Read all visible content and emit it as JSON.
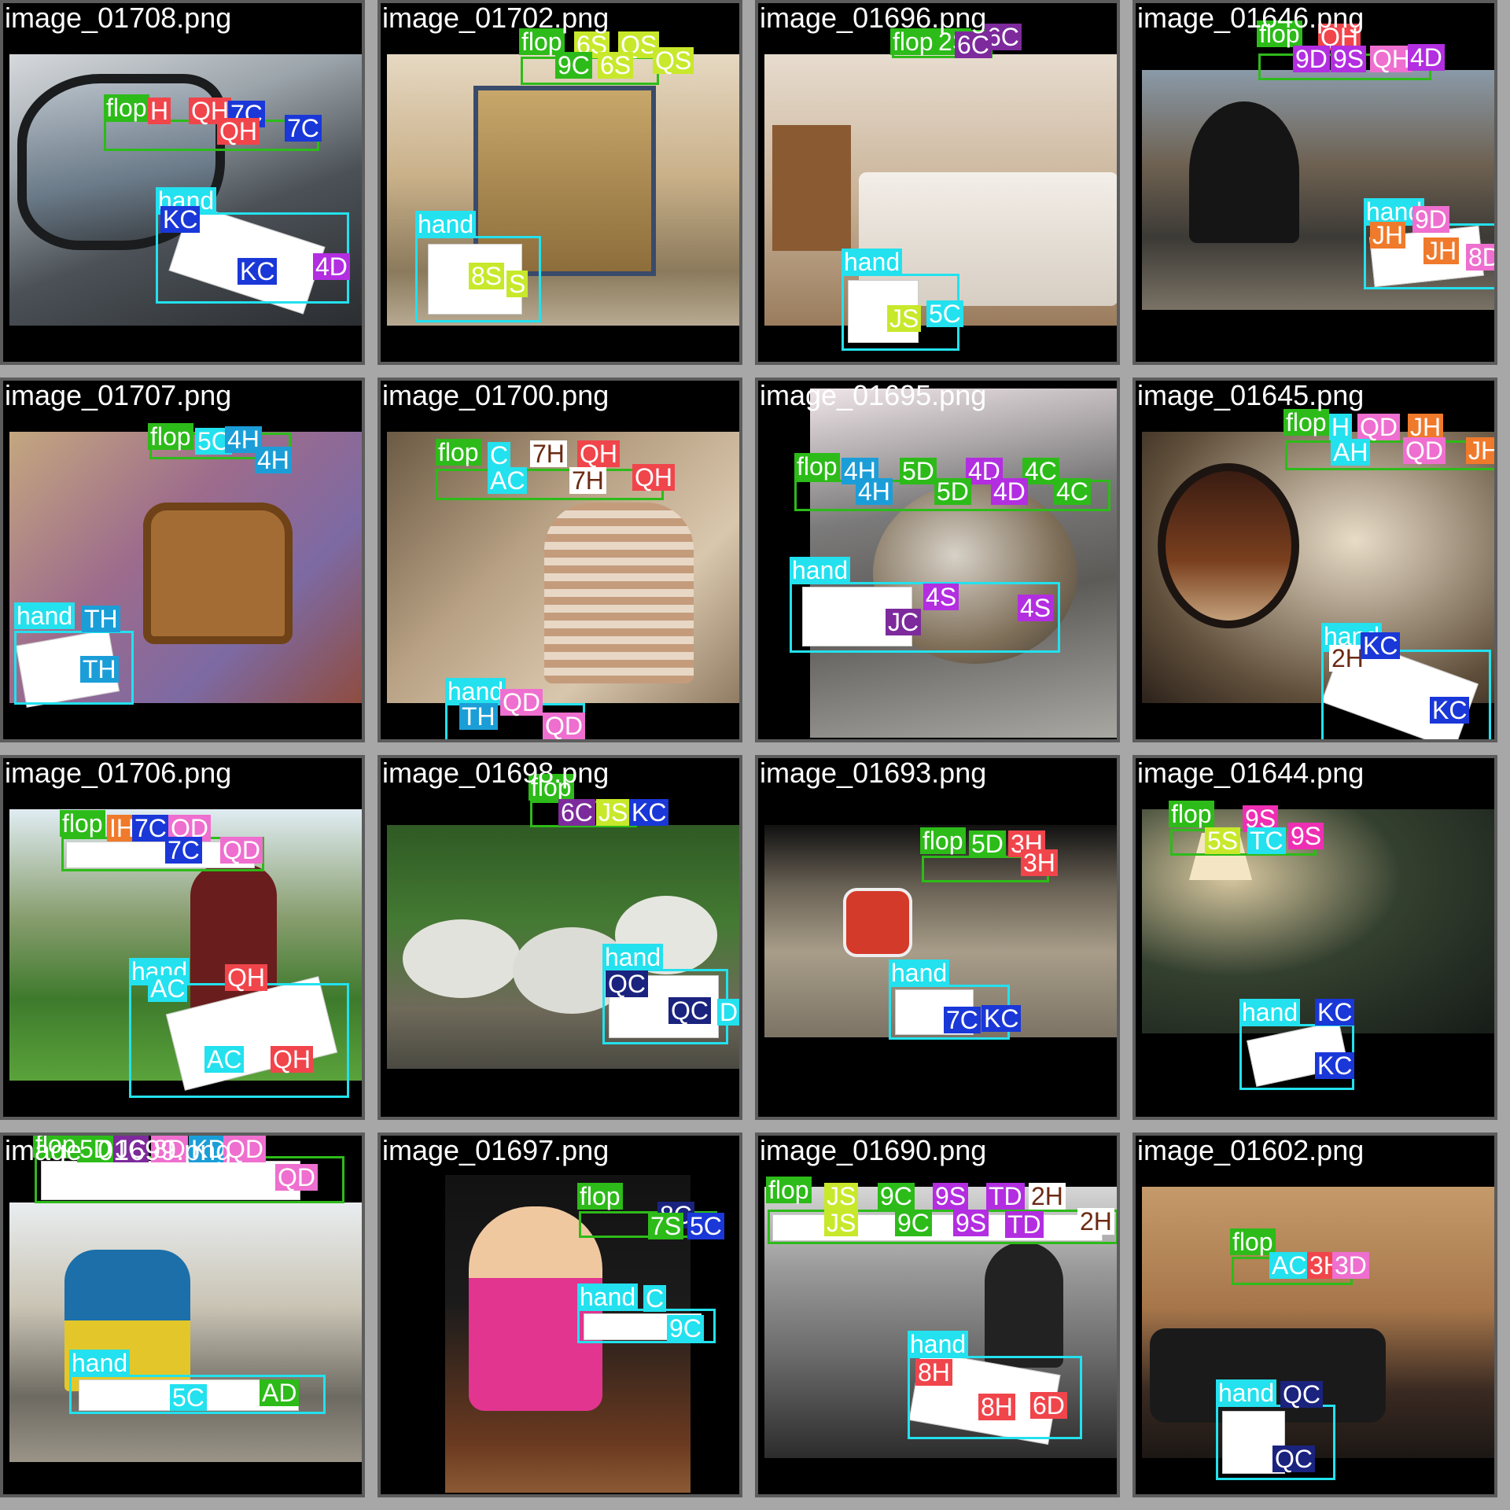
{
  "tiles": [
    {
      "file": "image_01708.png",
      "labels": [
        "flop",
        "H",
        "QH",
        "7C",
        "QH",
        "7C",
        "hand",
        "KC",
        "KC",
        "4D"
      ]
    },
    {
      "file": "image_01702.png",
      "labels": [
        "flop",
        "6S",
        "QS",
        "9C",
        "6S",
        "QS",
        "hand",
        "8S",
        "8S",
        "S"
      ]
    },
    {
      "file": "image_01696.png",
      "labels": [
        "flop",
        "2S",
        "6C",
        "6C",
        "hand",
        "JS",
        "5C"
      ]
    },
    {
      "file": "image_01646.png",
      "labels": [
        "flop",
        "QH",
        "9D",
        "9S",
        "QH",
        "4D",
        "hand",
        "JH",
        "9D",
        "JH",
        "8D"
      ]
    },
    {
      "file": "image_01707.png",
      "labels": [
        "flop",
        "5C",
        "4H",
        "4H",
        "hand",
        "TH",
        "TH"
      ]
    },
    {
      "file": "image_01700.png",
      "labels": [
        "flop",
        "C",
        "7H",
        "QH",
        "AC",
        "7H",
        "QH",
        "hand",
        "TH",
        "QD",
        "QD"
      ]
    },
    {
      "file": "image_01695.png",
      "labels": [
        "flop",
        "4H",
        "5D",
        "4D",
        "4C",
        "4H",
        "5D",
        "4D",
        "4C",
        "hand",
        "JC",
        "4S",
        "4S"
      ]
    },
    {
      "file": "image_01645.png",
      "labels": [
        "flop",
        "H",
        "QD",
        "JH",
        "AH",
        "QD",
        "JH",
        "hand",
        "2H",
        "KC",
        "KC"
      ]
    },
    {
      "file": "image_01706.png",
      "labels": [
        "flop",
        "IH",
        "7C",
        "QD",
        "7C",
        "QD",
        "hand",
        "QH",
        "AC",
        "AC",
        "QH"
      ]
    },
    {
      "file": "image_01698.png",
      "labels": [
        "flop",
        "6C",
        "JS",
        "KC",
        "hand",
        "QC",
        "QC",
        "D"
      ]
    },
    {
      "file": "image_01693.png",
      "labels": [
        "flop",
        "5D",
        "3H",
        "3H",
        "hand",
        "7C",
        "KC"
      ]
    },
    {
      "file": "image_01644.png",
      "labels": [
        "flop",
        "9S",
        "5S",
        "TC",
        "9S",
        "hand",
        "KC",
        "KC"
      ]
    },
    {
      "file": "image_01699.png",
      "labels": [
        "flop",
        "5D",
        "JC",
        "8D",
        "KD",
        "QD",
        "QD",
        "hand",
        "5C",
        "AD"
      ]
    },
    {
      "file": "image_01697.png",
      "labels": [
        "flop",
        "8C",
        "7S",
        "5C",
        "hand",
        "C",
        "9C"
      ]
    },
    {
      "file": "image_01690.png",
      "labels": [
        "flop",
        "JS",
        "9C",
        "9S",
        "TD",
        "2H",
        "JS",
        "9C",
        "9S",
        "TD",
        "2H",
        "hand",
        "8H",
        "8H",
        "6D"
      ]
    },
    {
      "file": "image_01602.png",
      "labels": [
        "flop",
        "AC",
        "3H",
        "3D",
        "hand",
        "QC",
        "QC"
      ]
    }
  ],
  "colors": {
    "flop": "#2dbb19",
    "hand": "#23e1ee",
    "H": "#f0454b",
    "C": "#1a37d8",
    "D": "#b22ee0",
    "S": "#c8e82b"
  }
}
